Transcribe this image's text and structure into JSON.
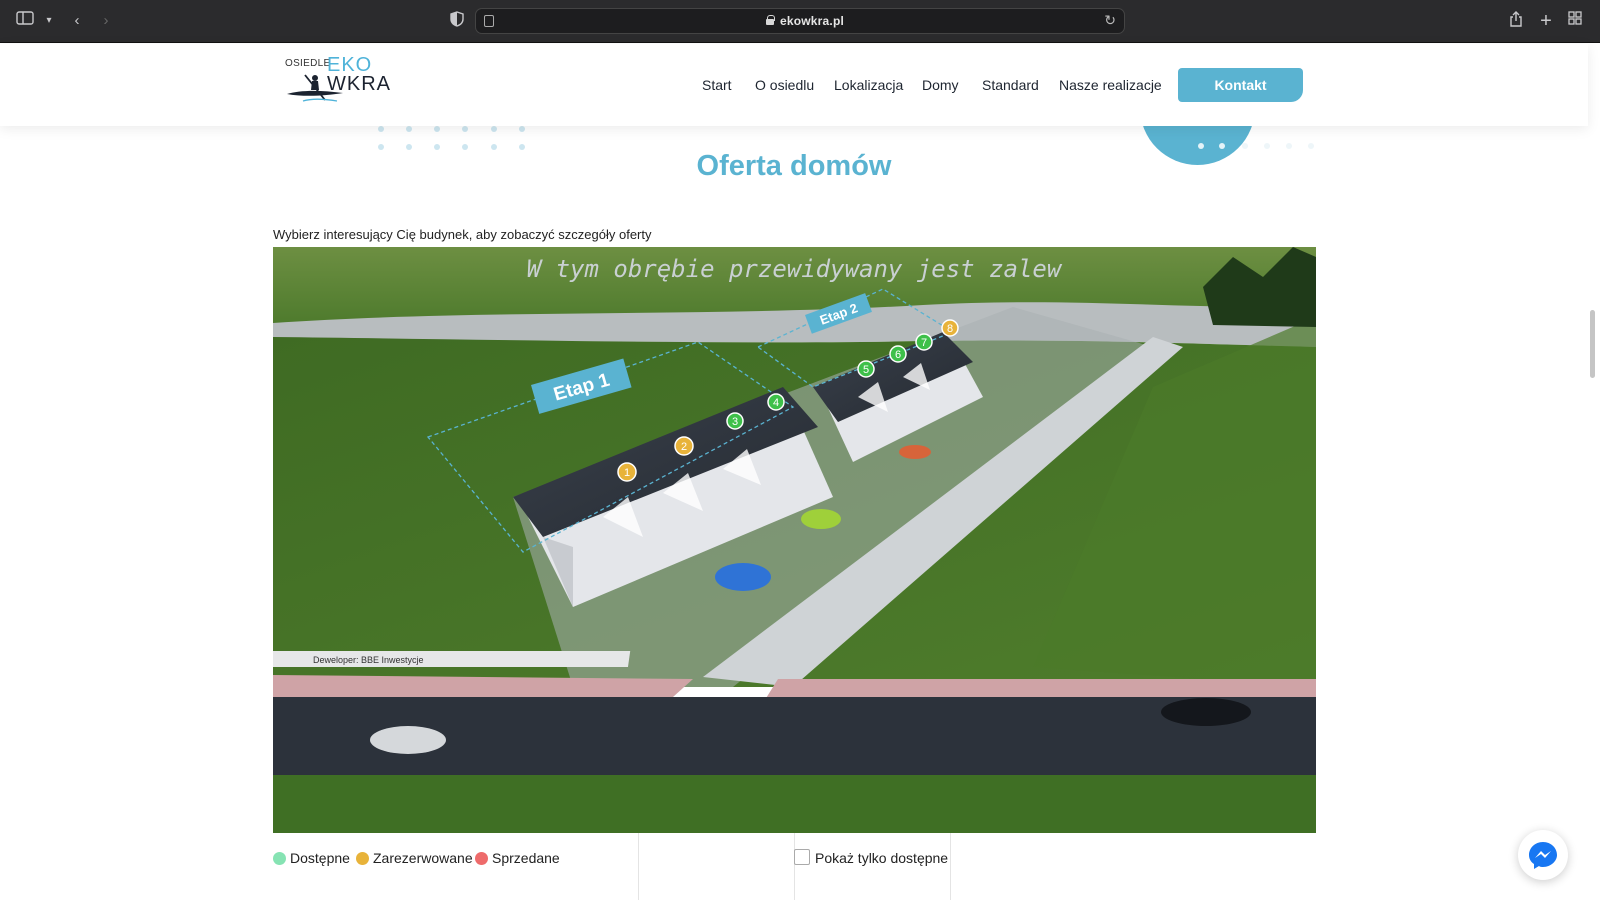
{
  "browser": {
    "url": "ekowkra.pl"
  },
  "logo": {
    "line1": "OSIEDLE",
    "line2": "EKO",
    "line3": "WKRA"
  },
  "nav": {
    "items": [
      "Start",
      "O osiedlu",
      "Lokalizacja",
      "Domy",
      "Standard",
      "Nasze realizacje"
    ],
    "cta": "Kontakt"
  },
  "main": {
    "title": "Oferta domów",
    "subtitle": "Wybierz interesujący Cię budynek, aby zobaczyć szczegóły oferty"
  },
  "scene": {
    "banner": "W tym obrębie przewidywany jest zalew",
    "stage1": "Etap 1",
    "stage2": "Etap 2",
    "developer": "Deweloper: BBE Inwestycje",
    "markers": [
      {
        "label": "1",
        "status": "reserved"
      },
      {
        "label": "2",
        "status": "reserved"
      },
      {
        "label": "3",
        "status": "available"
      },
      {
        "label": "4",
        "status": "available"
      },
      {
        "label": "5",
        "status": "available"
      },
      {
        "label": "6",
        "status": "available"
      },
      {
        "label": "7",
        "status": "available"
      },
      {
        "label": "8",
        "status": "reserved"
      }
    ]
  },
  "legend": {
    "available": "Dostępne",
    "reserved": "Zarezerwowane",
    "sold": "Sprzedane",
    "show_only_available": "Pokaż tylko dostępne"
  },
  "colors": {
    "accent": "#5ab3d1",
    "available": "#3ec04a",
    "reserved": "#e8b33a",
    "sold": "#ee6b6b",
    "legend_available": "#86e3b3"
  }
}
